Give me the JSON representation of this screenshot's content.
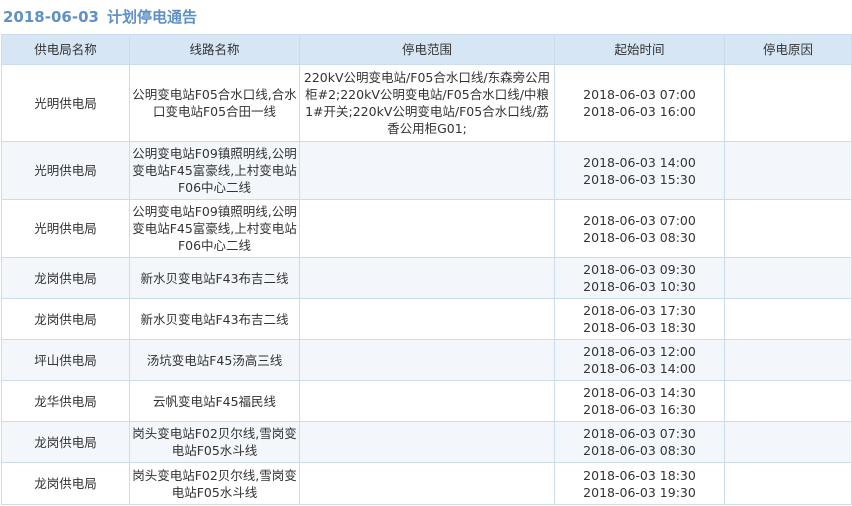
{
  "header": {
    "date": "2018-06-03",
    "title": "计划停电通告"
  },
  "table": {
    "columns": [
      "供电局名称",
      "线路名称",
      "停电范围",
      "起始时间",
      "停电原因"
    ],
    "rows": [
      {
        "bureau": "光明供电局",
        "line": "公明变电站F05合水口线,合水口变电站F05合田一线",
        "range": "220kV公明变电站/F05合水口线/东森旁公用柜#2;220kV公明变电站/F05合水口线/中粮1#开关;220kV公明变电站/F05合水口线/荔香公用柜G01;",
        "start": "2018-06-03 07:00",
        "end": "2018-06-03 16:00",
        "reason": ""
      },
      {
        "bureau": "光明供电局",
        "line": "公明变电站F09镇照明线,公明变电站F45富豪线,上村变电站F06中心二线",
        "range": "",
        "start": "2018-06-03 14:00",
        "end": "2018-06-03 15:30",
        "reason": ""
      },
      {
        "bureau": "光明供电局",
        "line": "公明变电站F09镇照明线,公明变电站F45富豪线,上村变电站F06中心二线",
        "range": "",
        "start": "2018-06-03 07:00",
        "end": "2018-06-03 08:30",
        "reason": ""
      },
      {
        "bureau": "龙岗供电局",
        "line": "新水贝变电站F43布吉二线",
        "range": "",
        "start": "2018-06-03 09:30",
        "end": "2018-06-03 10:30",
        "reason": ""
      },
      {
        "bureau": "龙岗供电局",
        "line": "新水贝变电站F43布吉二线",
        "range": "",
        "start": "2018-06-03 17:30",
        "end": "2018-06-03 18:30",
        "reason": ""
      },
      {
        "bureau": "坪山供电局",
        "line": "汤坑变电站F45汤高三线",
        "range": "",
        "start": "2018-06-03 12:00",
        "end": "2018-06-03 14:00",
        "reason": ""
      },
      {
        "bureau": "龙华供电局",
        "line": "云帆变电站F45福民线",
        "range": "",
        "start": "2018-06-03 14:30",
        "end": "2018-06-03 16:30",
        "reason": ""
      },
      {
        "bureau": "龙岗供电局",
        "line": "岗头变电站F02贝尔线,雪岗变电站F05水斗线",
        "range": "",
        "start": "2018-06-03 07:30",
        "end": "2018-06-03 08:30",
        "reason": ""
      },
      {
        "bureau": "龙岗供电局",
        "line": "岗头变电站F02贝尔线,雪岗变电站F05水斗线",
        "range": "",
        "start": "2018-06-03 18:30",
        "end": "2018-06-03 19:30",
        "reason": ""
      }
    ]
  }
}
